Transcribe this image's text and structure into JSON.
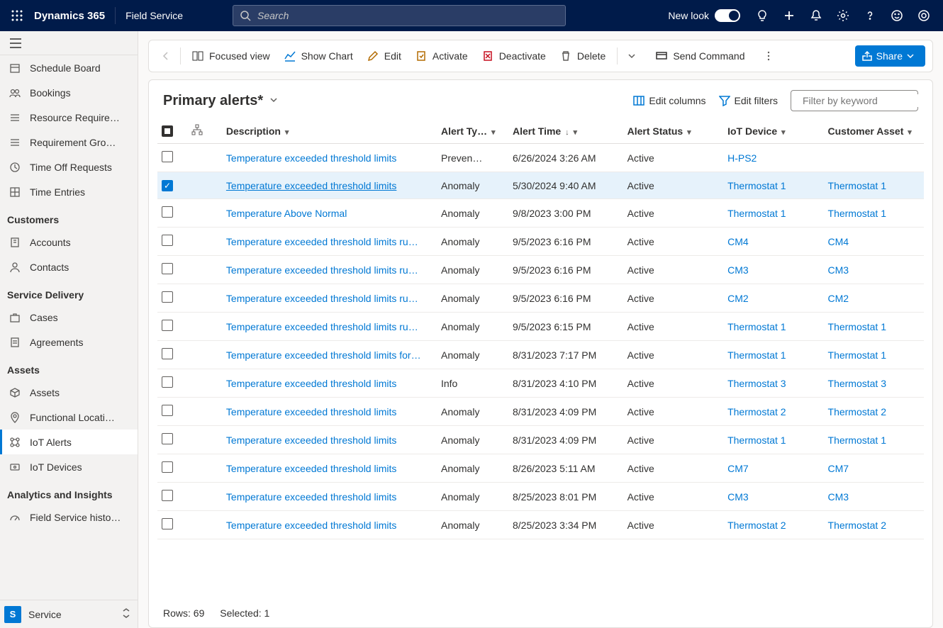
{
  "top": {
    "brand": "Dynamics 365",
    "module": "Field Service",
    "search_placeholder": "Search",
    "new_look": "New look"
  },
  "sidebar": {
    "groups": [
      {
        "title": null,
        "items": [
          {
            "label": "Schedule Board",
            "icon": "calendar"
          },
          {
            "label": "Bookings",
            "icon": "people"
          },
          {
            "label": "Resource Require…",
            "icon": "list"
          },
          {
            "label": "Requirement Gro…",
            "icon": "list"
          },
          {
            "label": "Time Off Requests",
            "icon": "clock"
          },
          {
            "label": "Time Entries",
            "icon": "grid"
          }
        ]
      },
      {
        "title": "Customers",
        "items": [
          {
            "label": "Accounts",
            "icon": "building"
          },
          {
            "label": "Contacts",
            "icon": "person"
          }
        ]
      },
      {
        "title": "Service Delivery",
        "items": [
          {
            "label": "Cases",
            "icon": "briefcase"
          },
          {
            "label": "Agreements",
            "icon": "doc"
          }
        ]
      },
      {
        "title": "Assets",
        "items": [
          {
            "label": "Assets",
            "icon": "cube"
          },
          {
            "label": "Functional Locati…",
            "icon": "pin"
          },
          {
            "label": "IoT Alerts",
            "icon": "alert",
            "active": true
          },
          {
            "label": "IoT Devices",
            "icon": "device"
          }
        ]
      },
      {
        "title": "Analytics and Insights",
        "items": [
          {
            "label": "Field Service histo…",
            "icon": "gauge"
          }
        ]
      }
    ],
    "area_badge": "S",
    "area_label": "Service"
  },
  "commands": {
    "focused_view": "Focused view",
    "show_chart": "Show Chart",
    "edit": "Edit",
    "activate": "Activate",
    "deactivate": "Deactivate",
    "delete": "Delete",
    "send_command": "Send Command",
    "share": "Share"
  },
  "content": {
    "view_title": "Primary alerts*",
    "edit_columns": "Edit columns",
    "edit_filters": "Edit filters",
    "filter_placeholder": "Filter by keyword",
    "rows_label": "Rows: 69",
    "selected_label": "Selected: 1"
  },
  "grid": {
    "columns": {
      "description": "Description",
      "alert_type": "Alert Ty…",
      "alert_time": "Alert Time",
      "alert_status": "Alert Status",
      "iot_device": "IoT Device",
      "customer_asset": "Customer Asset"
    },
    "rows": [
      {
        "desc": "Temperature exceeded threshold limits",
        "type": "Preven…",
        "time": "6/26/2024 3:26 AM",
        "status": "Active",
        "device": "H-PS2",
        "asset": ""
      },
      {
        "desc": "Temperature exceeded threshold limits",
        "type": "Anomaly",
        "time": "5/30/2024 9:40 AM",
        "status": "Active",
        "device": "Thermostat 1",
        "asset": "Thermostat 1",
        "selected": true
      },
      {
        "desc": "Temperature Above Normal",
        "type": "Anomaly",
        "time": "9/8/2023 3:00 PM",
        "status": "Active",
        "device": "Thermostat 1",
        "asset": "Thermostat 1"
      },
      {
        "desc": "Temperature exceeded threshold limits ru…",
        "type": "Anomaly",
        "time": "9/5/2023 6:16 PM",
        "status": "Active",
        "device": "CM4",
        "asset": "CM4"
      },
      {
        "desc": "Temperature exceeded threshold limits ru…",
        "type": "Anomaly",
        "time": "9/5/2023 6:16 PM",
        "status": "Active",
        "device": "CM3",
        "asset": "CM3"
      },
      {
        "desc": "Temperature exceeded threshold limits ru…",
        "type": "Anomaly",
        "time": "9/5/2023 6:16 PM",
        "status": "Active",
        "device": "CM2",
        "asset": "CM2"
      },
      {
        "desc": "Temperature exceeded threshold limits ru…",
        "type": "Anomaly",
        "time": "9/5/2023 6:15 PM",
        "status": "Active",
        "device": "Thermostat 1",
        "asset": "Thermostat 1"
      },
      {
        "desc": "Temperature exceeded threshold limits for…",
        "type": "Anomaly",
        "time": "8/31/2023 7:17 PM",
        "status": "Active",
        "device": "Thermostat 1",
        "asset": "Thermostat 1"
      },
      {
        "desc": "Temperature exceeded threshold limits",
        "type": "Info",
        "time": "8/31/2023 4:10 PM",
        "status": "Active",
        "device": "Thermostat 3",
        "asset": "Thermostat 3"
      },
      {
        "desc": "Temperature exceeded threshold limits",
        "type": "Anomaly",
        "time": "8/31/2023 4:09 PM",
        "status": "Active",
        "device": "Thermostat 2",
        "asset": "Thermostat 2"
      },
      {
        "desc": "Temperature exceeded threshold limits",
        "type": "Anomaly",
        "time": "8/31/2023 4:09 PM",
        "status": "Active",
        "device": "Thermostat 1",
        "asset": "Thermostat 1"
      },
      {
        "desc": "Temperature exceeded threshold limits",
        "type": "Anomaly",
        "time": "8/26/2023 5:11 AM",
        "status": "Active",
        "device": "CM7",
        "asset": "CM7"
      },
      {
        "desc": "Temperature exceeded threshold limits",
        "type": "Anomaly",
        "time": "8/25/2023 8:01 PM",
        "status": "Active",
        "device": "CM3",
        "asset": "CM3"
      },
      {
        "desc": "Temperature exceeded threshold limits",
        "type": "Anomaly",
        "time": "8/25/2023 3:34 PM",
        "status": "Active",
        "device": "Thermostat 2",
        "asset": "Thermostat 2"
      }
    ]
  }
}
